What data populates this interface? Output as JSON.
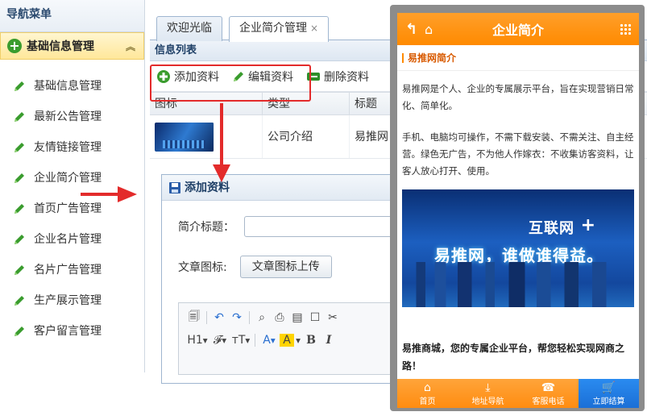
{
  "sidebar": {
    "title": "导航菜单",
    "group": "基础信息管理",
    "items": [
      {
        "label": "基础信息管理"
      },
      {
        "label": "最新公告管理"
      },
      {
        "label": "友情链接管理"
      },
      {
        "label": "企业简介管理"
      },
      {
        "label": "首页广告管理"
      },
      {
        "label": "企业名片管理"
      },
      {
        "label": "名片广告管理"
      },
      {
        "label": "生产展示管理"
      },
      {
        "label": "客户留言管理"
      }
    ]
  },
  "tabs": [
    {
      "label": "欢迎光临"
    },
    {
      "label": "企业简介管理",
      "close": "×"
    }
  ],
  "list": {
    "title": "信息列表",
    "toolbar": {
      "add": "添加资料",
      "edit": "编辑资料",
      "delete": "删除资料"
    },
    "columns": [
      "图标",
      "类型",
      "标题"
    ],
    "rows": [
      {
        "type": "公司介绍",
        "title": "易推网"
      }
    ]
  },
  "form": {
    "title": "添加资料",
    "title_label": "简介标题：",
    "icon_label": "文章图标:",
    "upload_button": "文章图标上传",
    "editor_row2": [
      "H1",
      "𝓕",
      "тT",
      "A",
      "A",
      "B",
      "I"
    ]
  },
  "phone": {
    "header_title": "企业简介",
    "subheader": "易推网简介",
    "para1": "易推网是个人、企业的专属展示平台，旨在实现营销日常化、简单化。",
    "para2": "手机、电脑均可操作，不需下载安装、不需关注、自主经营。绿色无广告，不为他人作嫁衣：不收集访客资料，让客人放心打开、使用。",
    "banner_line1": "互联网",
    "banner_plus": "+",
    "banner_line2": "易推网，谁做谁得益。",
    "bold_text": "易推商城，您的专属企业平台，帮您轻松实现网商之路！",
    "footer": [
      {
        "label": "首页",
        "icon": "home-icon"
      },
      {
        "label": "地址导航",
        "icon": "download-icon"
      },
      {
        "label": "客服电话",
        "icon": "phone-icon"
      },
      {
        "label": "立即结算",
        "icon": "cart-icon"
      }
    ]
  },
  "colors": {
    "accent_orange": "#ff8a00",
    "highlight_red": "#e32b2b",
    "pay_blue": "#1b6fd6"
  }
}
